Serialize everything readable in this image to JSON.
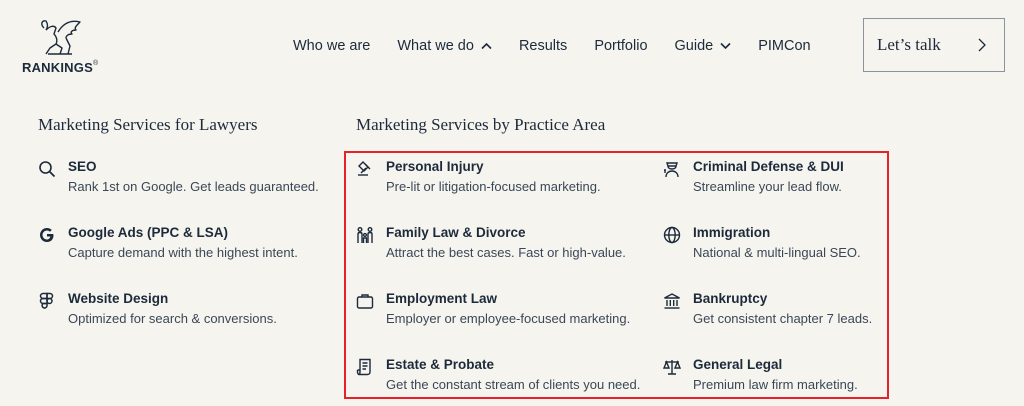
{
  "brand": {
    "logo_text": "RANKINGS",
    "registered": "®"
  },
  "nav": {
    "items": [
      {
        "label": "Who we are"
      },
      {
        "label": "What we do"
      },
      {
        "label": "Results"
      },
      {
        "label": "Portfolio"
      },
      {
        "label": "Guide"
      },
      {
        "label": "PIMCon"
      }
    ]
  },
  "cta": {
    "label": "Let’s talk"
  },
  "services": {
    "heading": "Marketing Services for Lawyers",
    "items": [
      {
        "title": "SEO",
        "desc": "Rank 1st on Google. Get leads guaranteed.",
        "icon": "search-icon"
      },
      {
        "title": "Google Ads (PPC & LSA)",
        "desc": "Capture demand with the highest intent.",
        "icon": "google-icon"
      },
      {
        "title": "Website Design",
        "desc": "Optimized for search & conversions.",
        "icon": "figma-icon"
      }
    ]
  },
  "practice": {
    "heading": "Marketing Services by Practice Area",
    "items": [
      {
        "title": "Personal Injury",
        "desc": "Pre-lit or litigation-focused marketing.",
        "icon": "gavel-icon"
      },
      {
        "title": "Criminal Defense & DUI",
        "desc": "Streamline your lead flow.",
        "icon": "officer-icon"
      },
      {
        "title": "Family Law & Divorce",
        "desc": "Attract the best cases. Fast or high-value.",
        "icon": "family-icon"
      },
      {
        "title": "Immigration",
        "desc": "National & multi-lingual SEO.",
        "icon": "globe-icon"
      },
      {
        "title": "Employment Law",
        "desc": "Employer or employee-focused marketing.",
        "icon": "briefcase-icon"
      },
      {
        "title": "Bankruptcy",
        "desc": "Get consistent chapter 7 leads.",
        "icon": "bank-icon"
      },
      {
        "title": "Estate & Probate",
        "desc": "Get the constant stream of clients you need.",
        "icon": "document-icon"
      },
      {
        "title": "General Legal",
        "desc": "Premium law firm marketing.",
        "icon": "scales-icon"
      }
    ]
  }
}
